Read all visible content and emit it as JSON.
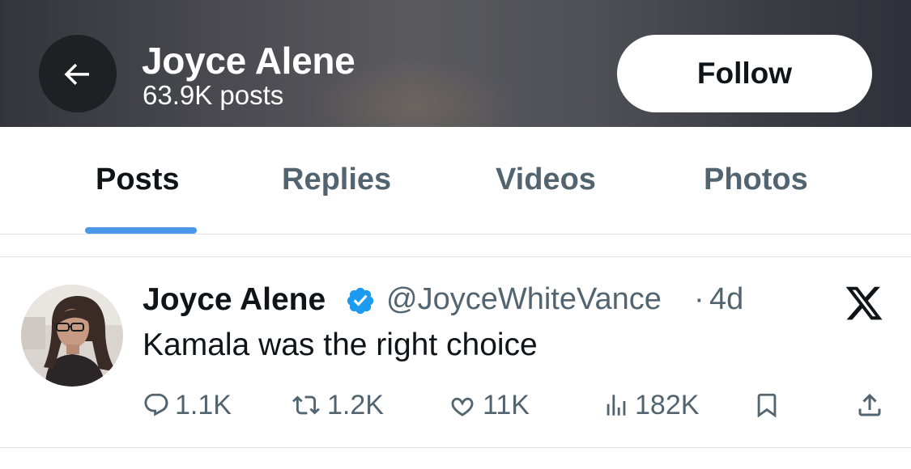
{
  "header": {
    "back_icon": "arrow-left-icon",
    "name": "Joyce Alene",
    "post_count": "63.9K posts",
    "follow_label": "Follow"
  },
  "tabs": [
    {
      "label": "Posts",
      "active": true
    },
    {
      "label": "Replies",
      "active": false
    },
    {
      "label": "Videos",
      "active": false
    },
    {
      "label": "Photos",
      "active": false
    }
  ],
  "post": {
    "author_name": "Joyce Alene",
    "verified_icon": "verified-badge-icon",
    "handle": "@JoyceWhiteVance",
    "separator": "·",
    "time": "4d",
    "source_icon": "x-logo-icon",
    "text": "Kamala was the right choice",
    "actions": {
      "replies": "1.1K",
      "reposts": "1.2K",
      "likes": "11K",
      "views": "182K"
    }
  },
  "colors": {
    "accent": "#4a99e9",
    "verified": "#1d9bf0",
    "secondary_text": "#536471",
    "primary_text": "#0f1419"
  }
}
